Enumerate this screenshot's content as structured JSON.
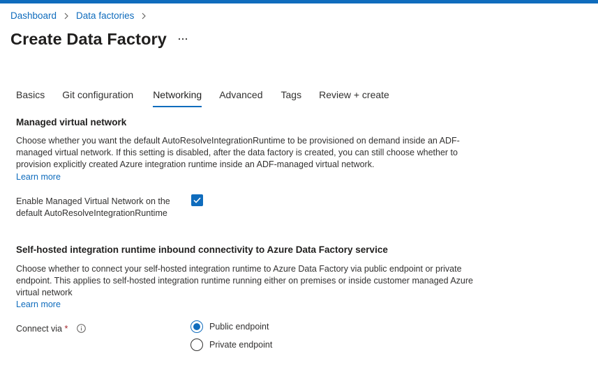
{
  "breadcrumb": {
    "items": [
      "Dashboard",
      "Data factories"
    ]
  },
  "page": {
    "title": "Create Data Factory",
    "more_label": "..."
  },
  "tabs": [
    {
      "label": "Basics",
      "active": false
    },
    {
      "label": "Git configuration",
      "active": false
    },
    {
      "label": "Networking",
      "active": true
    },
    {
      "label": "Advanced",
      "active": false
    },
    {
      "label": "Tags",
      "active": false
    },
    {
      "label": "Review + create",
      "active": false
    }
  ],
  "managed_vnet": {
    "title": "Managed virtual network",
    "description_lines": [
      "Choose whether you want the default AutoResolveIntegrationRuntime to be provisioned on demand inside an ADF-",
      "managed virtual network. If this setting is disabled, after the data factory is created, you can still choose whether to",
      "provision explicitly created Azure integration runtime inside an ADF-managed virtual network."
    ],
    "learn_more": "Learn more",
    "enable_label_lines": [
      "Enable Managed Virtual Network on the",
      "default AutoResolveIntegrationRuntime"
    ],
    "enabled": true
  },
  "self_hosted": {
    "title": "Self-hosted integration runtime inbound connectivity to Azure Data Factory service",
    "description_lines": [
      "Choose whether to connect your self-hosted integration runtime to Azure Data Factory via public endpoint or private",
      "endpoint. This applies to self-hosted integration runtime running either on premises or inside customer managed Azure",
      "virtual network"
    ],
    "learn_more": "Learn more",
    "connect_via_label": "Connect via",
    "required_mark": "*",
    "options": [
      {
        "label": "Public endpoint",
        "selected": true
      },
      {
        "label": "Private endpoint",
        "selected": false
      }
    ]
  },
  "colors": {
    "accent": "#0f6cbd",
    "required": "#a4262c",
    "text": "#323130"
  }
}
